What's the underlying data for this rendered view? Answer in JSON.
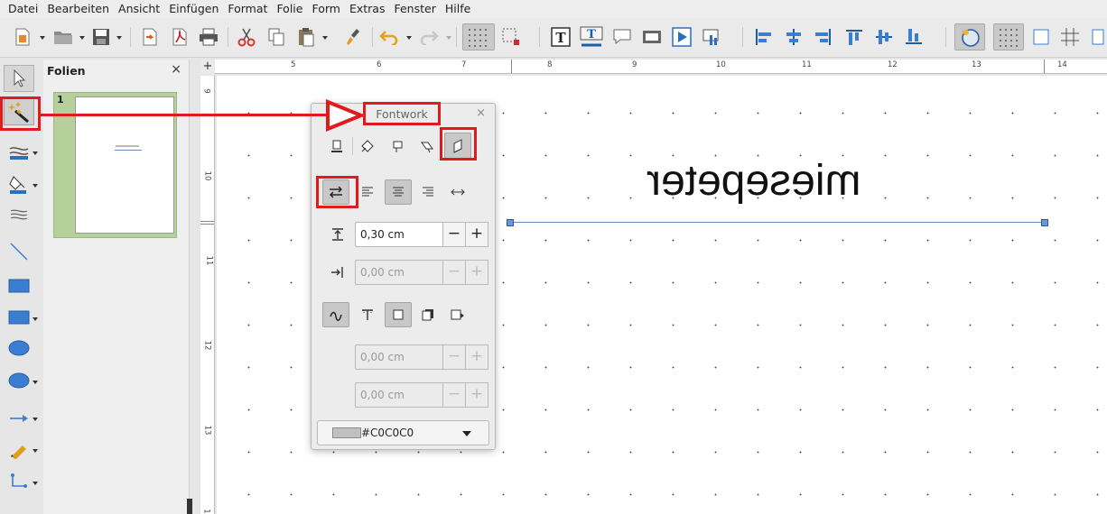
{
  "menubar": {
    "items": [
      "Datei",
      "Bearbeiten",
      "Ansicht",
      "Einfügen",
      "Format",
      "Folie",
      "Form",
      "Extras",
      "Fenster",
      "Hilfe"
    ]
  },
  "slide_panel": {
    "title": "Folien",
    "close": "×",
    "slide_number": "1"
  },
  "ruler": {
    "corner": "+",
    "h_labels": [
      "5",
      "6",
      "7",
      "8",
      "9",
      "10",
      "11",
      "12",
      "13",
      "14"
    ],
    "v_labels": [
      "9",
      "10",
      "11",
      "12",
      "13",
      "1"
    ]
  },
  "canvas": {
    "fontwork_text": "miesepeter"
  },
  "fontwork_dialog": {
    "title": "Fontwork",
    "close": "×",
    "distance_value": "0,30 cm",
    "indent_value": "0,00 cm",
    "shadow_x_value": "0,00 cm",
    "shadow_y_value": "0,00 cm",
    "minus": "−",
    "plus": "+",
    "shadow_color_label": "#C0C0C0",
    "shadow_color": "#c0c0c0"
  },
  "annotation_color": "#e11b1b"
}
